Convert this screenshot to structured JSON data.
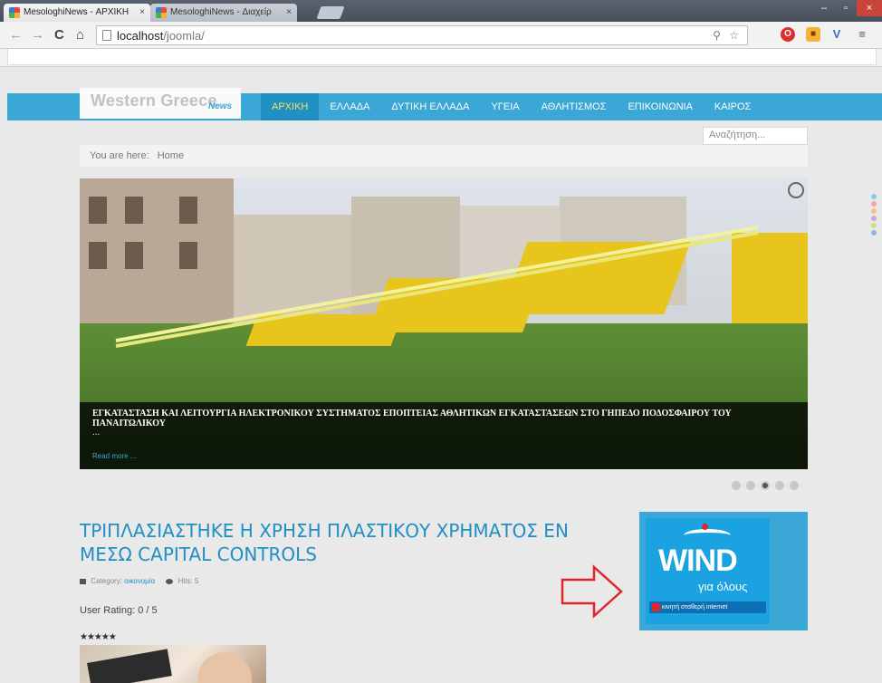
{
  "browser": {
    "tabs": [
      {
        "title": "MesologhiNews - ΑΡΧΙΚΗ",
        "active": true
      },
      {
        "title": "MesologhiNews - Διαχείρ",
        "active": false
      }
    ],
    "url_host": "localhost",
    "url_path": "/joomla/",
    "nav": {
      "back": "←",
      "forward": "→",
      "reload": "C",
      "home": "⌂"
    },
    "window_controls": {
      "minimize": "–",
      "restore": "▫",
      "close": "×"
    }
  },
  "site": {
    "logo_text": "Western Greece",
    "logo_sub": "News",
    "menu": [
      "ΑΡΧΙΚΗ",
      "ΕΛΛΑΔΑ",
      "ΔΥΤΙΚΗ ΕΛΛΑΔΑ",
      "ΥΓΕΙΑ",
      "ΑΘΛΗΤΙΣΜΟΣ",
      "ΕΠΙΚΟΙΝΩΝΙΑ",
      "ΚΑΙΡΟΣ"
    ],
    "search_placeholder": "Αναζήτηση...",
    "breadcrumb": {
      "label": "You are here:",
      "item": "Home"
    }
  },
  "slider": {
    "caption": "ΕΓΚΑΤΑΣΤΑΣΗ ΚΑΙ ΛΕΙΤΟΥΡΓΙΑ ΗΛΕΚΤΡΟΝΙΚΟΥ ΣΥΣΤΗΜΑΤΟΣ ΕΠΟΠΤΕΙΑΣ ΑΘΛΗΤΙΚΩΝ ΕΓΚΑΤΑΣΤΑΣΕΩΝ ΣΤΟ ΓΗΠΕΔΟ ΠΟΔΟΣΦΑΙΡΟΥ ΤΟΥ ΠΑΝΑΙΤΩΛΙΚΟΥ",
    "ellipsis": "...",
    "read_more": "Read more ...",
    "slide_count": 5,
    "active_slide": 3
  },
  "article": {
    "title": "ΤΡΙΠΛΑΣΙΑΣΤΗΚΕ Η ΧΡΗΣΗ ΠΛΑΣΤΙΚΟΥ ΧΡΗΜΑΤΟΣ ΕΝ ΜΕΣΩ CAPITAL CONTROLS",
    "category_label": "Category:",
    "category": "οικονομία",
    "hits": "Hits: 5",
    "rating": "User Rating: 0 / 5",
    "stars": "★★★★★"
  },
  "ad": {
    "brand": "WIND",
    "tagline": "για όλους",
    "strip": "κινητή σταθερή internet"
  },
  "colors": {
    "accent": "#3aa7d6",
    "active_menu": "#f5e16a",
    "arrow": "#e3252b"
  }
}
